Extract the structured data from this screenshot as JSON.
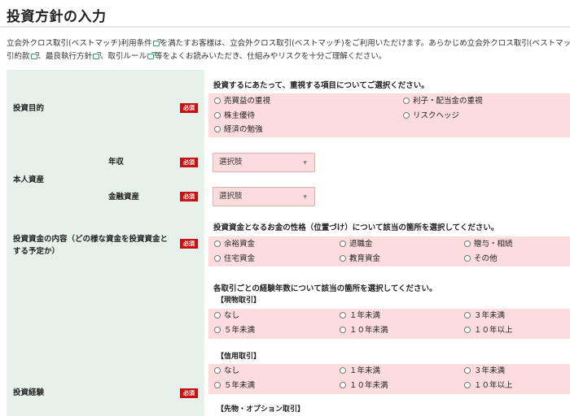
{
  "page_title": "投資方針の入力",
  "intro": {
    "line1_a": "立会外クロス取引(ベストマッチ)利用条件",
    "line1_b": "を満たすお客様は、立会外クロス取引(ベストマッチ)をご利用いただけます。あらかじめ立会外クロス取引(ベストマッチ)契",
    "line2_a": "引約款",
    "line2_b": "、最良執行方針",
    "line2_c": "、取引ルール",
    "line2_d": "等をよくお読みいただき、仕組みやリスクを十分ご理解ください。"
  },
  "required_label": "必須",
  "investment_purpose": {
    "label": "投資目的",
    "question": "投資するにあたって、重視する項目についてご選択ください。",
    "options": [
      "売買益の重視",
      "利子・配当金の重視",
      "株主優待",
      "リスクヘッジ",
      "経済の勉強"
    ]
  },
  "personal_assets": {
    "label": "本人資産",
    "income_label": "年収",
    "financial_label": "金融資産",
    "income_select": "選択肢",
    "financial_select": "選択肢"
  },
  "fund_content": {
    "label_line1": "投資資金の内容（どの様な資金を投資資金と",
    "label_line2": "する予定か）",
    "question": "投資資金となるお金の性格（位置づけ）について該当の箇所を選択してください。",
    "options": [
      "余裕資金",
      "退職金",
      "贈与・相続",
      "住宅資金",
      "教育資金",
      "その他"
    ]
  },
  "experience": {
    "label": "投資経験",
    "question": "各取引ごとの経験年数について該当の箇所を選択してください。",
    "spot_label": "【現物取引】",
    "spot_options": [
      "なし",
      "１年未満",
      "３年未満",
      "５年未満",
      "１０年未満",
      "１０年以上"
    ],
    "margin_label": "【信用取引】",
    "margin_options": [
      "なし",
      "１年未満",
      "３年未満",
      "５年未満",
      "１０年未満",
      "１０年以上"
    ],
    "futures_label": "【先物・オプション取引】"
  }
}
